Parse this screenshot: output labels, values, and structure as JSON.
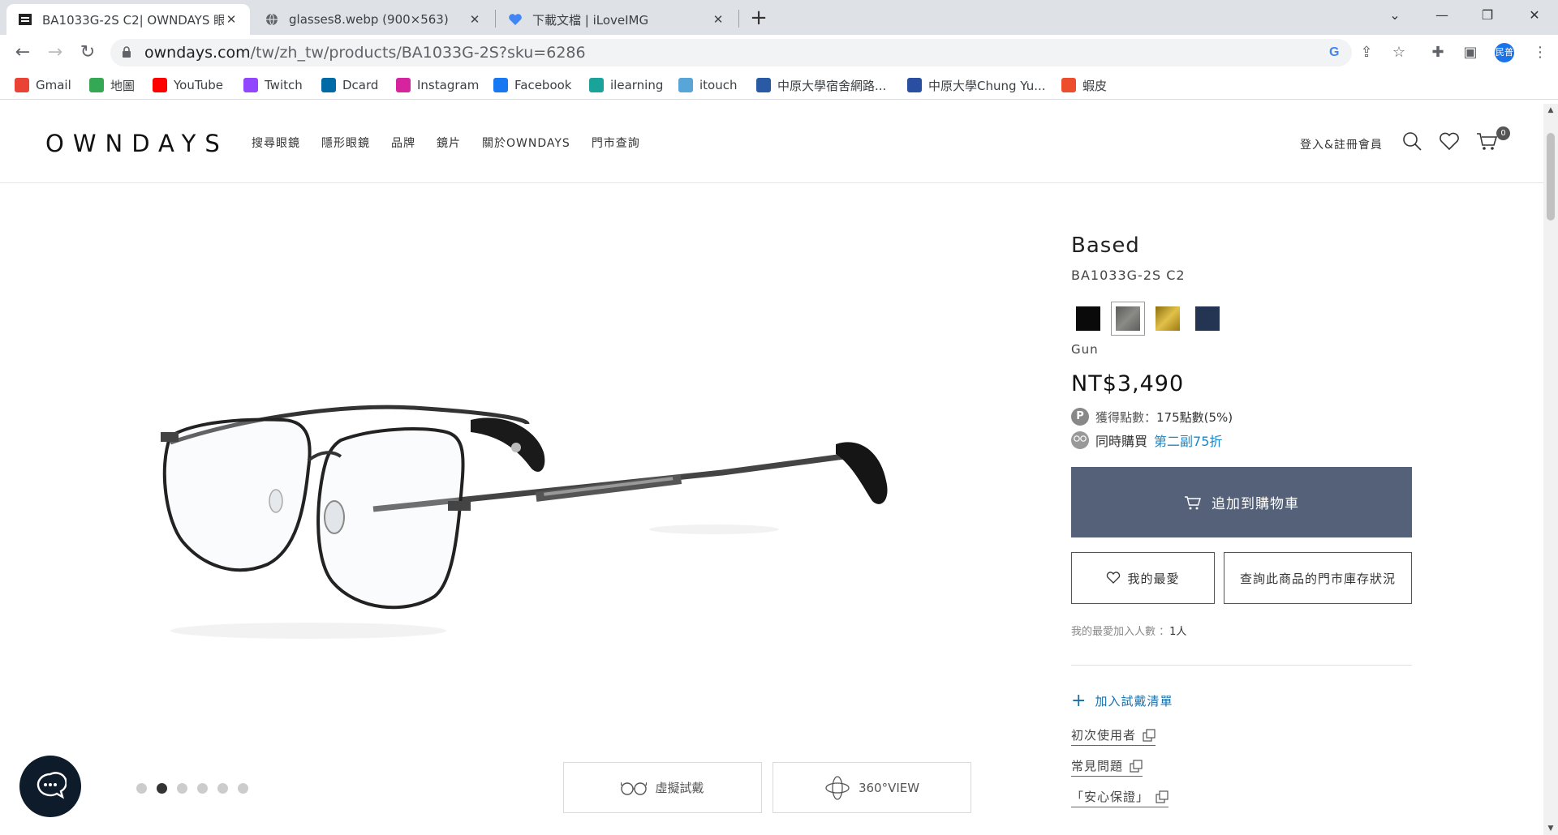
{
  "browser": {
    "tabs": [
      {
        "title": "BA1033G-2S C2| OWNDAYS 眼",
        "active": true
      },
      {
        "title": "glasses8.webp (900×563)",
        "active": false
      },
      {
        "title": "下載文檔 | iLoveIMG",
        "active": false
      }
    ],
    "url_host": "owndays.com",
    "url_path": "/tw/zh_tw/products/BA1033G-2S?sku=6286",
    "profile_label": "民普",
    "bookmarks": [
      {
        "label": "Gmail",
        "icon": "gmail-icon",
        "color": "#ea4335"
      },
      {
        "label": "地圖",
        "icon": "maps-icon",
        "color": "#34a853"
      },
      {
        "label": "YouTube",
        "icon": "youtube-icon",
        "color": "#ff0000"
      },
      {
        "label": "Twitch",
        "icon": "twitch-icon",
        "color": "#9146ff"
      },
      {
        "label": "Dcard",
        "icon": "dcard-icon",
        "color": "#006aa6"
      },
      {
        "label": "Instagram",
        "icon": "instagram-icon",
        "color": "#d6249f"
      },
      {
        "label": "Facebook",
        "icon": "facebook-icon",
        "color": "#1877f2"
      },
      {
        "label": "ilearning",
        "icon": "ilearning-icon",
        "color": "#1aa39a"
      },
      {
        "label": "itouch",
        "icon": "itouch-icon",
        "color": "#58a6d8"
      },
      {
        "label": "中原大學宿舍網路...",
        "icon": "dorm-icon",
        "color": "#2b5aa5"
      },
      {
        "label": "中原大學Chung Yu...",
        "icon": "cycu-icon",
        "color": "#2b4fa0"
      },
      {
        "label": "蝦皮",
        "icon": "shopee-icon",
        "color": "#ee4d2d"
      }
    ]
  },
  "header": {
    "logo": "OWNDAYS",
    "nav": [
      "搜尋眼鏡",
      "隱形眼鏡",
      "品牌",
      "鏡片",
      "關於OWNDAYS",
      "門市查詢"
    ],
    "login": "登入&註冊會員",
    "cart_count": "0"
  },
  "product": {
    "brand": "Based",
    "sku": "BA1033G-2S C2",
    "colors": [
      {
        "name": "black",
        "hex": "#0a0a0a"
      },
      {
        "name": "gun",
        "hex": "#6e6f6a"
      },
      {
        "name": "gold",
        "hex": "#c9a227"
      },
      {
        "name": "navy",
        "hex": "#243554"
      }
    ],
    "selected_color": "Gun",
    "price": "NT$3,490",
    "points_label": "獲得點數：",
    "points_value": "175點數(5%)",
    "pair_label": "同時購買",
    "pair_link": "第二副75折",
    "add_to_cart": "追加到購物車",
    "favorite": "我的最愛",
    "stock_check": "查詢此商品的門市庫存狀況",
    "fav_count_label": "我的最愛加入人數 ：",
    "fav_count": "1人",
    "try_list": "加入試戴清單",
    "links": [
      "初次使用者",
      "常見問題",
      "「安心保證」"
    ],
    "virtual_try": "虛擬試戴",
    "view360": "360°VIEW",
    "image_index": 2,
    "image_count": 6
  }
}
